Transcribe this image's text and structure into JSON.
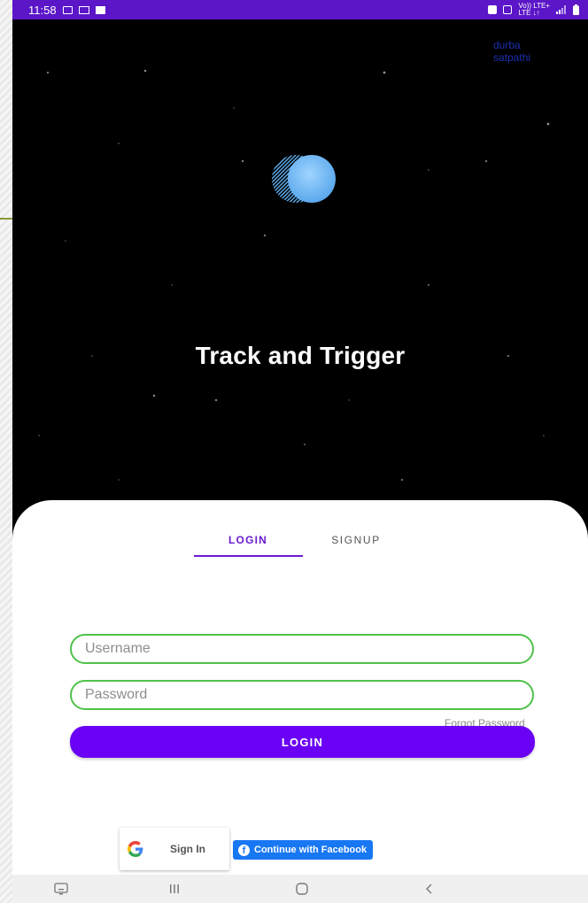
{
  "status_bar": {
    "time": "11:58",
    "left_icons": [
      "gallery-icon",
      "video-icon",
      "checkbox-icon"
    ],
    "right_icons": [
      "alarm-icon",
      "mute-icon",
      "volte-lte-icon",
      "signal-icon",
      "battery-icon"
    ],
    "network_label_top": "Vo)) LTE+",
    "network_label_bottom": "LTE ↓↑",
    "background": "#5b16c7"
  },
  "watermark": {
    "line1": "durba",
    "line2": "satpathi",
    "color": "#1d2fb0"
  },
  "hero": {
    "title": "Track and Trigger",
    "logo_icon": "planet-logo-icon"
  },
  "auth": {
    "tabs": [
      {
        "label": "LOGIN",
        "active": true
      },
      {
        "label": "SIGNUP",
        "active": false
      }
    ],
    "username_placeholder": "Username",
    "password_placeholder": "Password",
    "forgot_password": "Forgot Password",
    "login_button": "LOGIN",
    "accent_color": "#6a00f4",
    "field_border_color": "#4fc24a"
  },
  "social": {
    "google_label": "Sign In",
    "facebook_label": "Continue with Facebook",
    "facebook_color": "#1877f2"
  },
  "nav_bar": {
    "items": [
      "keyboard-icon",
      "recent-apps-icon",
      "home-icon",
      "back-icon"
    ]
  }
}
